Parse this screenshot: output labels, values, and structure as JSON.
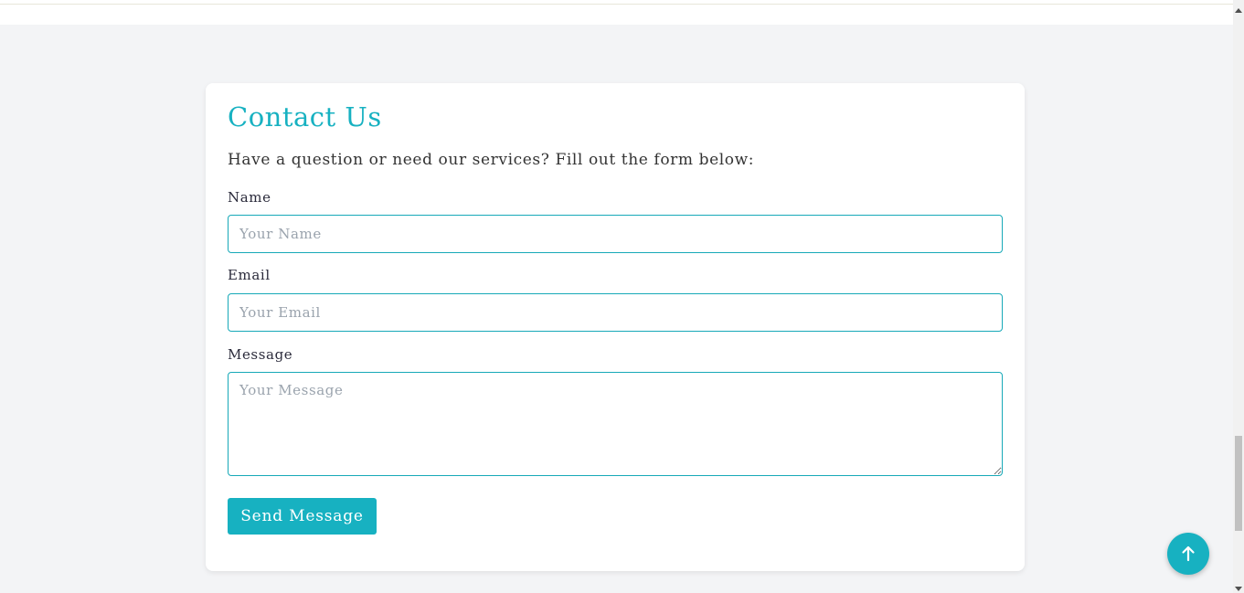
{
  "contact": {
    "title": "Contact Us",
    "subtitle": "Have a question or need our services? Fill out the form below:",
    "name_label": "Name",
    "name_placeholder": "Your Name",
    "name_value": "",
    "email_label": "Email",
    "email_placeholder": "Your Email",
    "email_value": "",
    "message_label": "Message",
    "message_placeholder": "Your Message",
    "message_value": "",
    "submit_label": "Send Message"
  },
  "back_to_top": {
    "icon": "arrow-up-icon"
  },
  "colors": {
    "accent": "#17b1c1",
    "page_background": "#f3f4f6",
    "card_background": "#ffffff"
  }
}
